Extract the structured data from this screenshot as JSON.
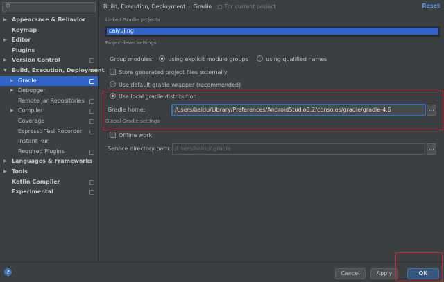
{
  "sidebar": {
    "search": {
      "placeholder": ""
    },
    "items": [
      {
        "label": "Appearance & Behavior",
        "level": 0,
        "arrow": "▶"
      },
      {
        "label": "Keymap",
        "level": 0
      },
      {
        "label": "Editor",
        "level": 0,
        "arrow": "▶"
      },
      {
        "label": "Plugins",
        "level": 0
      },
      {
        "label": "Version Control",
        "level": 0,
        "arrow": "▶",
        "project": true
      },
      {
        "label": "Build, Execution, Deployment",
        "level": 0,
        "arrow": "▼"
      },
      {
        "label": "Gradle",
        "level": 1,
        "arrow": "▶",
        "selected": true,
        "project": true
      },
      {
        "label": "Debugger",
        "level": 1,
        "arrow": "▶"
      },
      {
        "label": "Remote Jar Repositories",
        "level": 1,
        "project": true
      },
      {
        "label": "Compiler",
        "level": 1,
        "arrow": "▶",
        "project": true
      },
      {
        "label": "Coverage",
        "level": 1,
        "project": true
      },
      {
        "label": "Espresso Test Recorder",
        "level": 1,
        "project": true
      },
      {
        "label": "Instant Run",
        "level": 1
      },
      {
        "label": "Required Plugins",
        "level": 1,
        "project": true
      },
      {
        "label": "Languages & Frameworks",
        "level": 0,
        "arrow": "▶"
      },
      {
        "label": "Tools",
        "level": 0,
        "arrow": "▶"
      },
      {
        "label": "Kotlin Compiler",
        "level": 0,
        "project": true
      },
      {
        "label": "Experimental",
        "level": 0,
        "project": true
      }
    ]
  },
  "header": {
    "crumb1": "Build, Execution, Deployment",
    "separator": "›",
    "crumb2": "Gradle",
    "scope": "For current project",
    "reset": "Reset"
  },
  "content": {
    "linked_projects_label": "Linked Gradle projects",
    "linked_project": "caiyujing",
    "project_level_label": "Project-level settings",
    "group_modules_label": "Group modules:",
    "group_opt1": "using explicit module groups",
    "group_opt2": "using qualified names",
    "store_external": "Store generated project files externally",
    "use_default_wrapper": "Use default gradle wrapper (recommended)",
    "use_local_dist": "Use local gradle distribution",
    "gradle_home_label": "Gradle home:",
    "gradle_home_value": "/Users/baidu/Library/Preferences/AndroidStudio3.2/consoles/gradle/gradle-4.6",
    "browse": "...",
    "global_settings_label": "Global Gradle settings",
    "offline_work": "Offline work",
    "service_dir_label": "Service directory path:",
    "service_dir_value": "/Users/baidu/.gradle"
  },
  "footer": {
    "help": "?",
    "cancel": "Cancel",
    "apply": "Apply",
    "ok": "OK"
  },
  "colors": {
    "selection": "#2f65ca",
    "highlight_box": "#d0262c",
    "link": "#589df6"
  }
}
